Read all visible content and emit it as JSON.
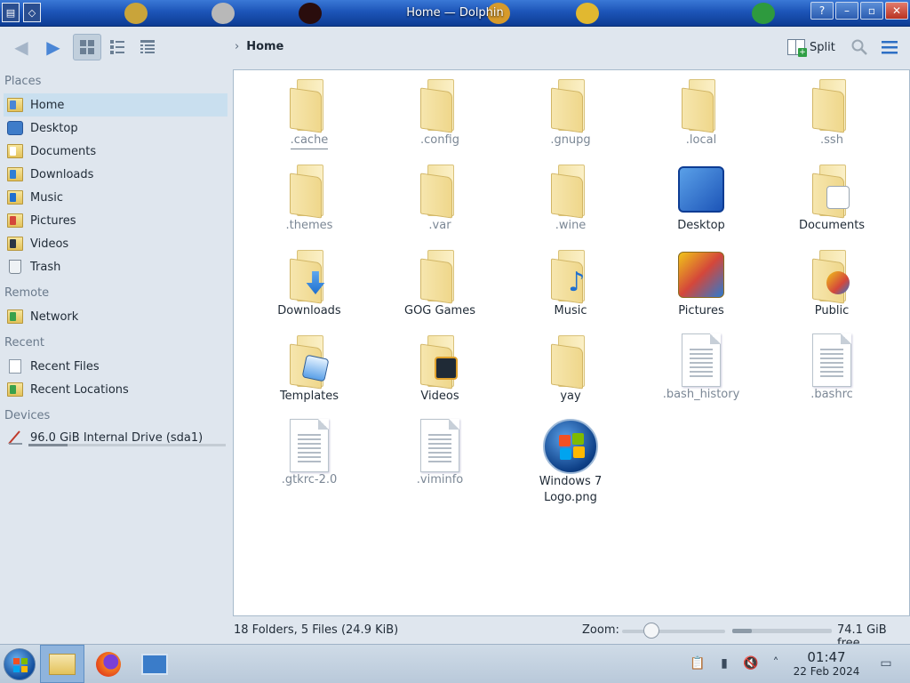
{
  "window": {
    "title": "Home — Dolphin"
  },
  "toolbar": {
    "back_icon": "back-arrow-icon",
    "forward_icon": "forward-arrow-icon",
    "breadcrumb_location": "Home",
    "split_label": "Split"
  },
  "sidebar": {
    "sections": {
      "places": "Places",
      "remote": "Remote",
      "recent": "Recent",
      "devices": "Devices"
    },
    "places": [
      {
        "label": "Home"
      },
      {
        "label": "Desktop"
      },
      {
        "label": "Documents"
      },
      {
        "label": "Downloads"
      },
      {
        "label": "Music"
      },
      {
        "label": "Pictures"
      },
      {
        "label": "Videos"
      },
      {
        "label": "Trash"
      }
    ],
    "remote": [
      {
        "label": "Network"
      }
    ],
    "recent": [
      {
        "label": "Recent Files"
      },
      {
        "label": "Recent Locations"
      }
    ],
    "devices": [
      {
        "label": "96.0 GiB Internal Drive (sda1)",
        "usage_fraction": 0.2
      }
    ]
  },
  "files": [
    {
      "name": ".cache",
      "kind": "folder"
    },
    {
      "name": ".config",
      "kind": "folder"
    },
    {
      "name": ".gnupg",
      "kind": "folder"
    },
    {
      "name": ".local",
      "kind": "folder"
    },
    {
      "name": ".ssh",
      "kind": "folder"
    },
    {
      "name": ".themes",
      "kind": "folder"
    },
    {
      "name": ".var",
      "kind": "folder"
    },
    {
      "name": ".wine",
      "kind": "folder"
    },
    {
      "name": "Desktop",
      "kind": "desktop"
    },
    {
      "name": "Documents",
      "kind": "folder-documents"
    },
    {
      "name": "Downloads",
      "kind": "folder-downloads"
    },
    {
      "name": "GOG Games",
      "kind": "folder"
    },
    {
      "name": "Music",
      "kind": "folder-music"
    },
    {
      "name": "Pictures",
      "kind": "pictures"
    },
    {
      "name": "Public",
      "kind": "folder-public"
    },
    {
      "name": "Templates",
      "kind": "folder-templates"
    },
    {
      "name": "Videos",
      "kind": "folder-videos"
    },
    {
      "name": "yay",
      "kind": "folder"
    },
    {
      "name": ".bash_history",
      "kind": "text"
    },
    {
      "name": ".bashrc",
      "kind": "text"
    },
    {
      "name": ".gtkrc-2.0",
      "kind": "text"
    },
    {
      "name": ".viminfo",
      "kind": "text"
    },
    {
      "name": "Windows 7 Logo.png",
      "kind": "image-png"
    }
  ],
  "statusbar": {
    "summary": "18 Folders, 5 Files (24.9 KiB)",
    "zoom_label": "Zoom:",
    "free_space": "74.1 GiB free",
    "free_space_used_fraction": 0.2
  },
  "taskbar": {
    "time": "01:47",
    "date": "22 Feb 2024"
  },
  "colors": {
    "accent": "#3b86d8",
    "selection": "#c9dfef",
    "folder": "#f1dc95"
  }
}
